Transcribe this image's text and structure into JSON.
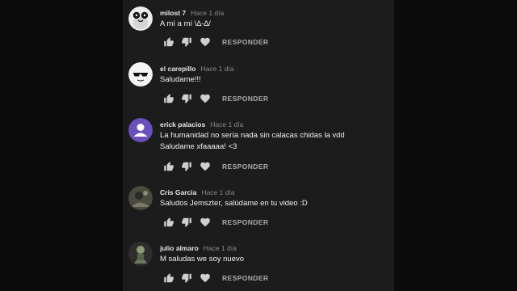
{
  "comments": [
    {
      "author": "milost 7",
      "time": "Hace 1 día",
      "text": [
        "A mí a mí \\∆-∆/"
      ],
      "reply_label": "RESPONDER",
      "avatar_icon": "penguin-avatar-icon",
      "avatar_color": "#e8e8e8"
    },
    {
      "author": "el carepillo",
      "time": "Hace 1 día",
      "text": [
        "Saludame!!!"
      ],
      "reply_label": "RESPONDER",
      "avatar_icon": "sunglasses-face-avatar-icon",
      "avatar_color": "#f2f2f2"
    },
    {
      "author": "erick palacios",
      "time": "Hace 1 día",
      "text": [
        "La humanidad no sería nada sin calacas chidas la vdd",
        "Saludame xfaaaaa! <3"
      ],
      "reply_label": "RESPONDER",
      "avatar_icon": "default-user-avatar-icon",
      "avatar_color": "#6b4fbb"
    },
    {
      "author": "Cris Garcia",
      "time": "Hace 1 día",
      "text": [
        "Saludos Jemszter, salúdame en tu video :D"
      ],
      "reply_label": "RESPONDER",
      "avatar_icon": "photo-avatar-icon",
      "avatar_color": "#5a5a4a"
    },
    {
      "author": "julio almaro",
      "time": "Hace 1 día",
      "text": [
        "M saludas we soy nuevo"
      ],
      "reply_label": "RESPONDER",
      "avatar_icon": "figure-avatar-icon",
      "avatar_color": "#6e7a5e"
    }
  ],
  "icons": {
    "like": "thumbs-up-icon",
    "dislike": "thumbs-down-icon",
    "heart": "heart-icon"
  },
  "colors": {
    "panel_bg": "#1c1c1c",
    "outer_bg": "#0b0b0b",
    "text": "#f0f0f0",
    "meta": "#8a8a8a",
    "icon": "#cfcfcf"
  }
}
